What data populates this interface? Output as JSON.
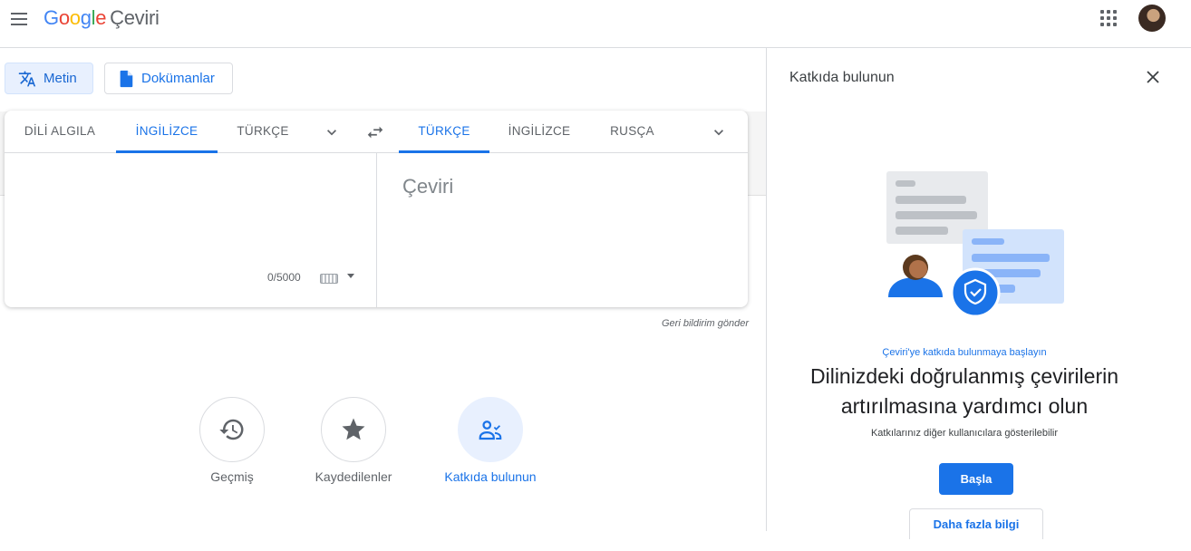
{
  "header": {
    "logo_letters": [
      "G",
      "o",
      "o",
      "g",
      "l",
      "e"
    ],
    "product_name": "Çeviri"
  },
  "modes": {
    "text_label": "Metin",
    "documents_label": "Dokümanlar"
  },
  "source_languages": [
    {
      "label": "DİLİ ALGILA",
      "selected": false
    },
    {
      "label": "İNGİLİZCE",
      "selected": true
    },
    {
      "label": "TÜRKÇE",
      "selected": false
    }
  ],
  "target_languages": [
    {
      "label": "TÜRKÇE",
      "selected": true
    },
    {
      "label": "İNGİLİZCE",
      "selected": false
    },
    {
      "label": "RUSÇA",
      "selected": false
    }
  ],
  "source": {
    "value": "",
    "char_count": "0/5000"
  },
  "target": {
    "placeholder": "Çeviri"
  },
  "feedback_link": "Geri bildirim gönder",
  "actions": [
    {
      "label": "Geçmiş",
      "icon": "history-icon"
    },
    {
      "label": "Kaydedilenler",
      "icon": "star-icon"
    },
    {
      "label": "Katkıda bulunun",
      "icon": "contribute-icon"
    }
  ],
  "panel": {
    "title": "Katkıda bulunun",
    "subtitle": "Çeviri'ye katkıda bulunmaya başlayın",
    "heading": "Dilinizdeki doğrulanmış çevirilerin artırılmasına yardımcı olun",
    "note": "Katkılarınız diğer kullanıcılara gösterilebilir",
    "start_label": "Başla",
    "more_label": "Daha fazla bilgi"
  },
  "colors": {
    "accent": "#1a73e8",
    "selected_bg": "#e8f0fe",
    "border": "#dadce0"
  }
}
